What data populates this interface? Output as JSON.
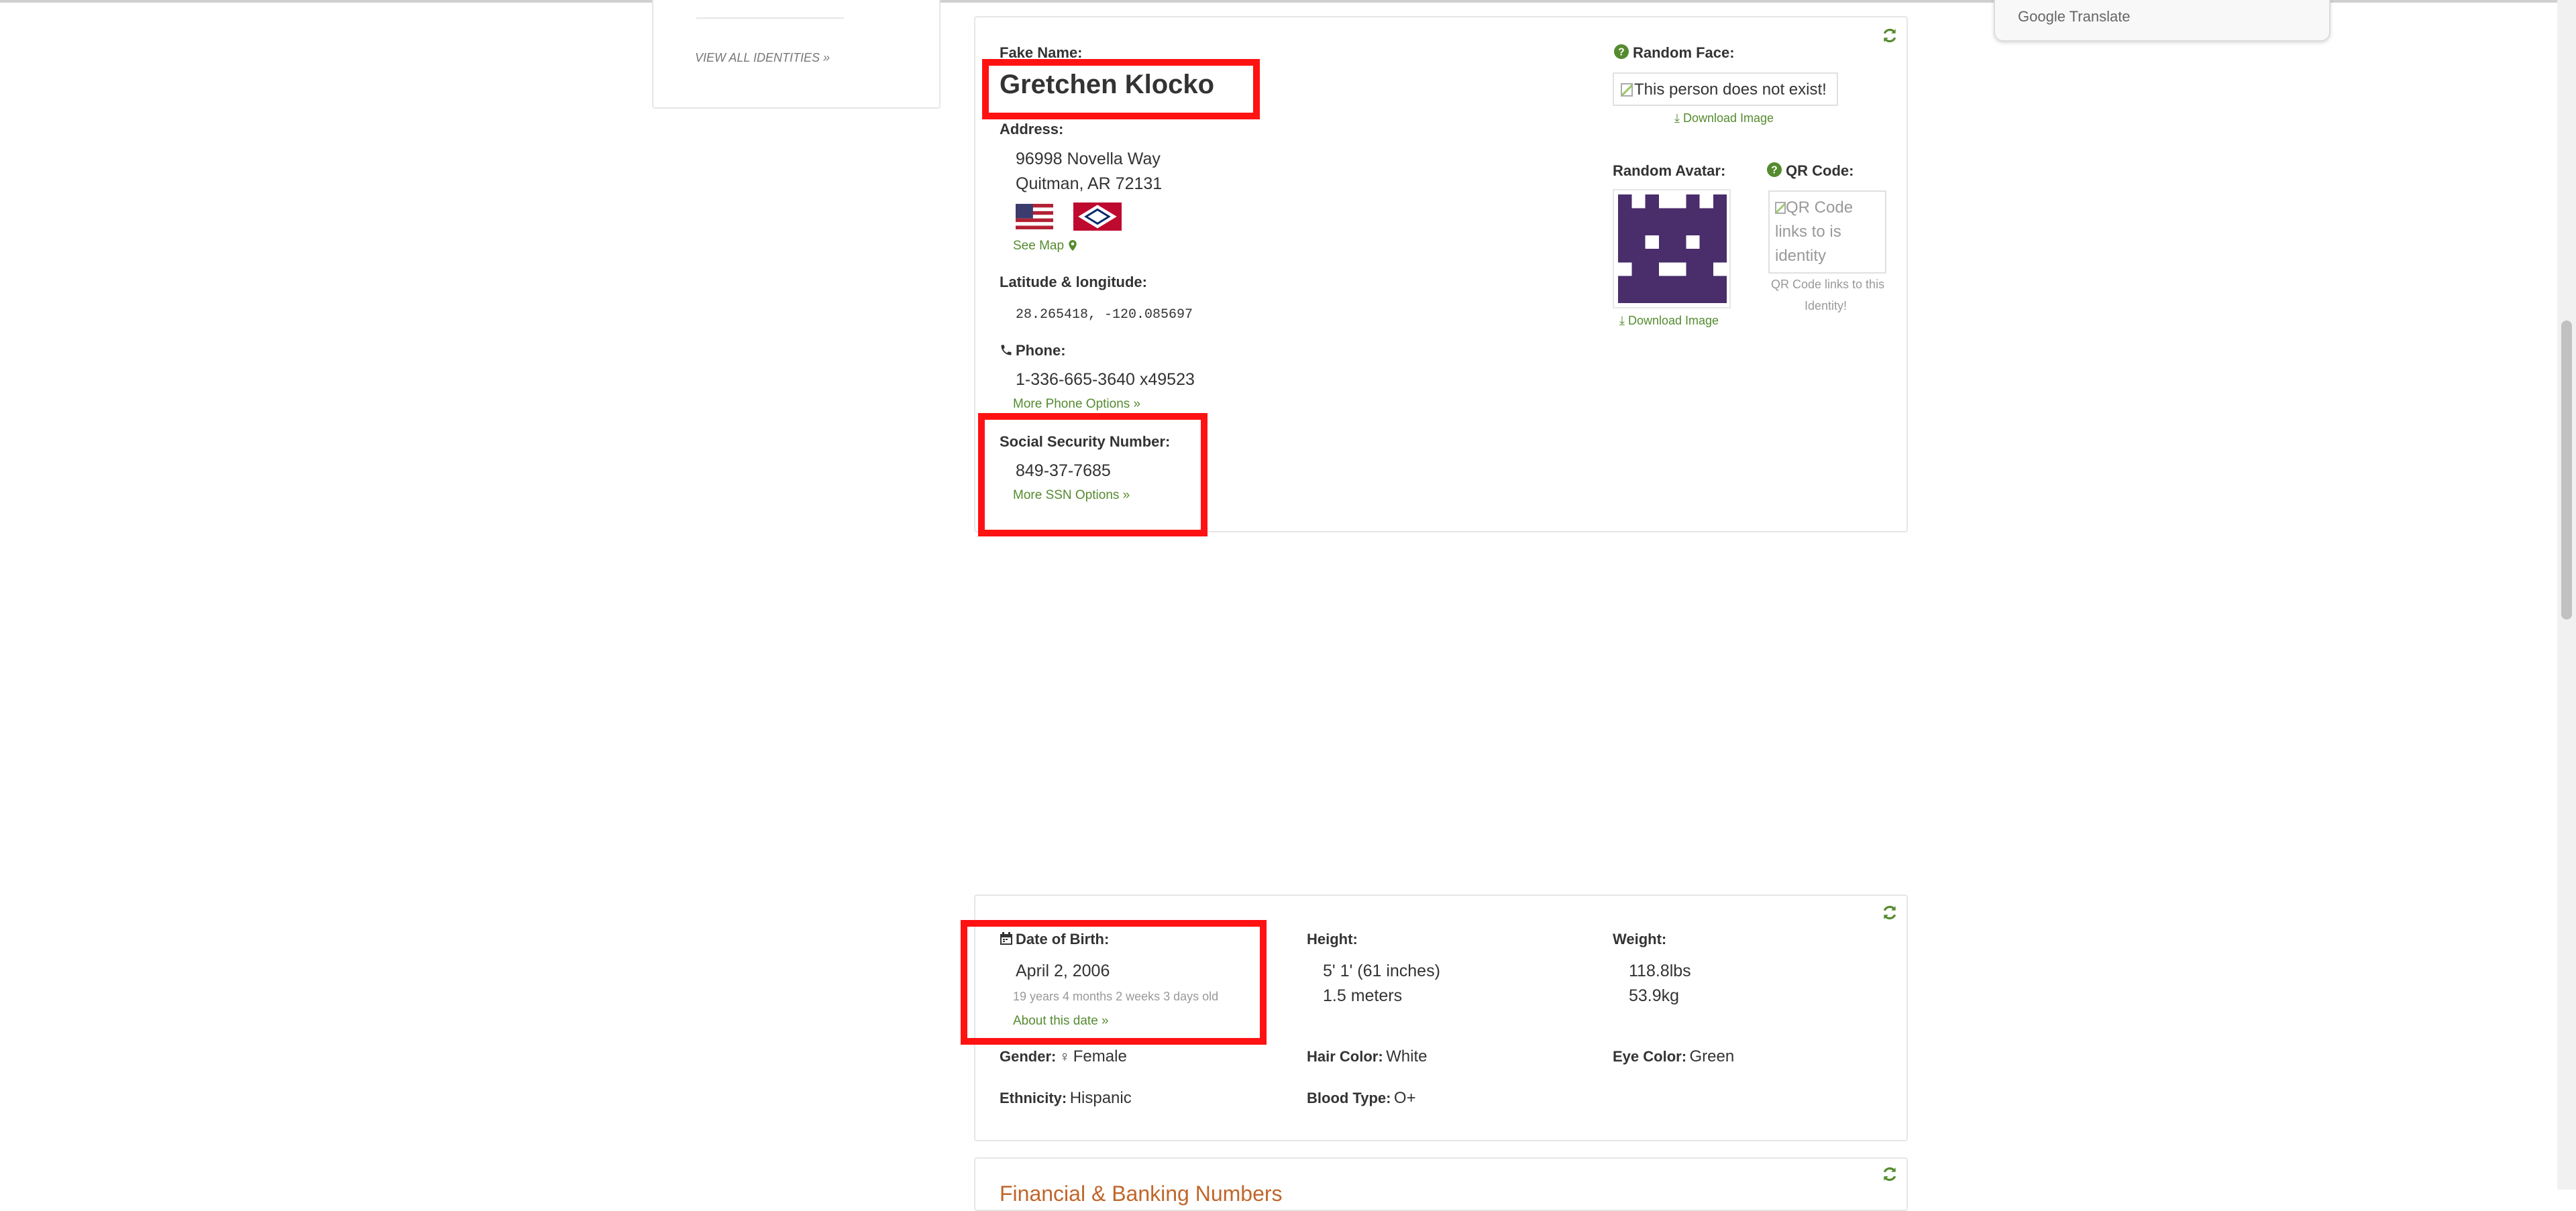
{
  "colors": {
    "link": "#558b2f",
    "highlight": "#ff1212",
    "avatar": "#4a2d6b"
  },
  "sidebar": {
    "view_all_label": "VIEW ALL IDENTITIES »"
  },
  "translate": {
    "label": "Google Translate"
  },
  "identity": {
    "fake_name_label": "Fake Name:",
    "name": "Gretchen Klocko",
    "address_label": "Address:",
    "address_line1": "96998 Novella Way",
    "address_line2": "Quitman, AR 72131",
    "see_map_label": "See Map",
    "latlong_label": "Latitude & longitude:",
    "latlong_value": "28.265418, -120.085697",
    "phone_label": "Phone:",
    "phone_value": "1-336-665-3640 x49523",
    "more_phone_label": "More Phone Options »",
    "ssn_label": "Social Security Number:",
    "ssn_value": "849-37-7685",
    "more_ssn_label": "More SSN Options »",
    "random_face_label": "Random Face:",
    "face_alt": "This person does not exist!",
    "download_image_label": "Download Image",
    "random_avatar_label": "Random Avatar:",
    "avatar_download_label": "Download Image",
    "qr_label": "QR Code:",
    "qr_alt": "QR Code links to is identity",
    "qr_caption_line1": "QR Code links to this",
    "qr_caption_line2": "Identity!"
  },
  "details": {
    "dob_label": "Date of Birth:",
    "dob_value": "April 2, 2006",
    "age_text": "19 years 4 months 2 weeks 3 days old",
    "about_date_label": "About this date »",
    "height_label": "Height:",
    "height_imperial": "5' 1' (61 inches)",
    "height_metric": "1.5 meters",
    "weight_label": "Weight:",
    "weight_lbs": "118.8lbs",
    "weight_kg": "53.9kg",
    "gender_label": "Gender:",
    "gender_value": "Female",
    "hair_label": "Hair Color:",
    "hair_value": "White",
    "eye_label": "Eye Color:",
    "eye_value": "Green",
    "ethnicity_label": "Ethnicity:",
    "ethnicity_value": "Hispanic",
    "blood_label": "Blood Type:",
    "blood_value": "O+"
  },
  "next_section": {
    "title_partial": "Financial & Banking Numbers"
  }
}
